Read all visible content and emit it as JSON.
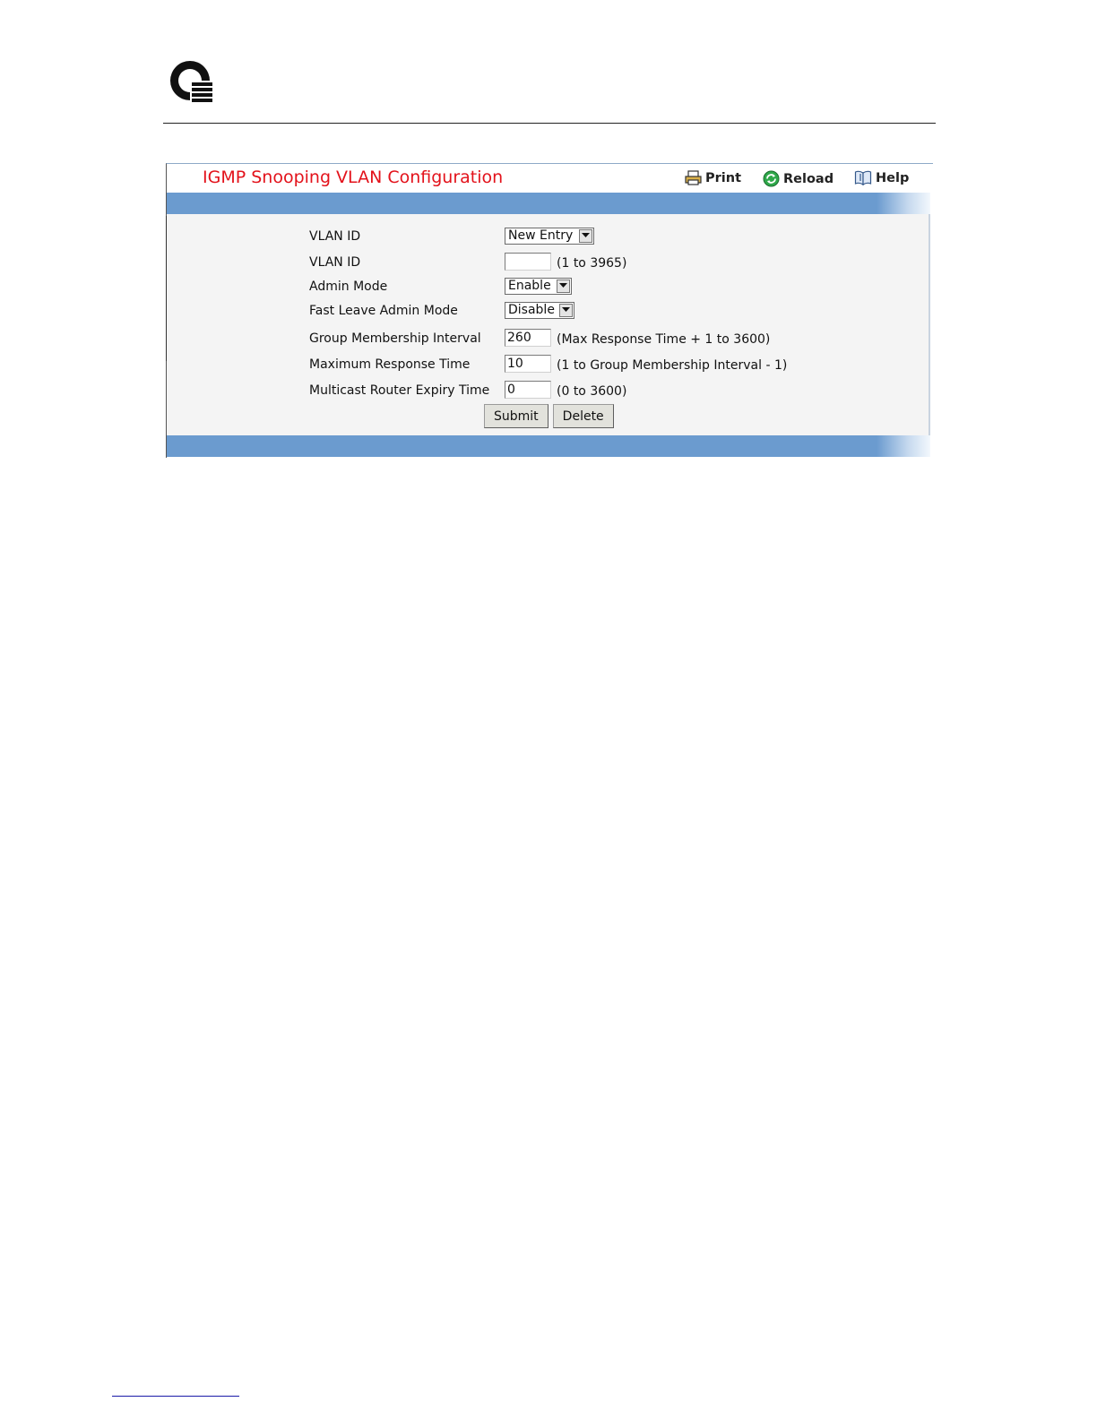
{
  "page": {
    "title": "IGMP Snooping VLAN Configuration"
  },
  "toolbar": {
    "print_label": "Print",
    "reload_label": "Reload",
    "help_label": "Help"
  },
  "form": {
    "vlan_select": {
      "label": "VLAN ID",
      "value": "New Entry"
    },
    "vlan_id": {
      "label": "VLAN ID",
      "value": "",
      "hint": "(1 to 3965)"
    },
    "admin_mode": {
      "label": "Admin Mode",
      "value": "Enable"
    },
    "fast_leave": {
      "label": "Fast Leave Admin Mode",
      "value": "Disable"
    },
    "group_membership_interval": {
      "label": "Group Membership Interval",
      "value": "260",
      "hint": "(Max Response Time + 1 to 3600)"
    },
    "max_response_time": {
      "label": "Maximum Response Time",
      "value": "10",
      "hint": "(1 to Group Membership Interval - 1)"
    },
    "mrouter_expiry": {
      "label": "Multicast Router Expiry Time",
      "value": "0",
      "hint": "(0 to 3600)"
    },
    "submit_label": "Submit",
    "delete_label": "Delete"
  },
  "colors": {
    "title_red": "#e3121b",
    "bar_blue": "#6b9bcf",
    "form_bg": "#f4f4f4"
  }
}
